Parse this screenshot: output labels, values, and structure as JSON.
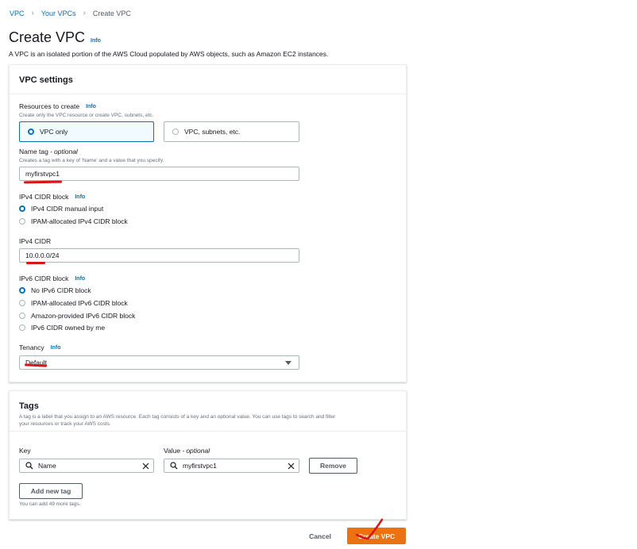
{
  "breadcrumb": {
    "items": [
      "VPC",
      "Your VPCs"
    ],
    "current": "Create VPC"
  },
  "page": {
    "title": "Create VPC",
    "info": "Info",
    "description": "A VPC is an isolated portion of the AWS Cloud populated by AWS objects, such as Amazon EC2 instances."
  },
  "vpc_settings": {
    "title": "VPC settings",
    "resources": {
      "label": "Resources to create",
      "info": "Info",
      "hint": "Create only the VPC resource or create VPC, subnets, etc.",
      "options": [
        "VPC only",
        "VPC, subnets, etc."
      ],
      "selected": "VPC only"
    },
    "name_tag": {
      "label": "Name tag - ",
      "optional": "optional",
      "hint": "Creates a tag with a key of 'Name' and a value that you specify.",
      "value": "myfirstvpc1"
    },
    "ipv4_block": {
      "label": "IPv4 CIDR block",
      "info": "Info",
      "options": [
        "IPv4 CIDR manual input",
        "IPAM-allocated IPv4 CIDR block"
      ],
      "selected": "IPv4 CIDR manual input"
    },
    "ipv4_cidr": {
      "label": "IPv4 CIDR",
      "value": "10.0.0.0/24"
    },
    "ipv6_block": {
      "label": "IPv6 CIDR block",
      "info": "Info",
      "options": [
        "No IPv6 CIDR block",
        "IPAM-allocated IPv6 CIDR block",
        "Amazon-provided IPv6 CIDR block",
        "IPv6 CIDR owned by me"
      ],
      "selected": "No IPv6 CIDR block"
    },
    "tenancy": {
      "label": "Tenancy",
      "info": "Info",
      "value": "Default"
    }
  },
  "tags": {
    "title": "Tags",
    "description_1": "A tag is a label that you assign to an AWS resource. Each tag consists of a key and an optional value. You can use tags to search and filter",
    "description_2": "your resources or track your AWS costs.",
    "key_label": "Key",
    "value_label": "Value - ",
    "value_optional": "optional",
    "key_value": "Name",
    "value_value": "myfirstvpc1",
    "remove_label": "Remove",
    "add_label": "Add new tag",
    "limit_hint": "You can add 49 more tags."
  },
  "actions": {
    "cancel_label": "Cancel",
    "create_label": "Create VPC"
  },
  "colors": {
    "link": "#0073bb",
    "primary": "#ec7211",
    "annotation": "#d91515"
  }
}
